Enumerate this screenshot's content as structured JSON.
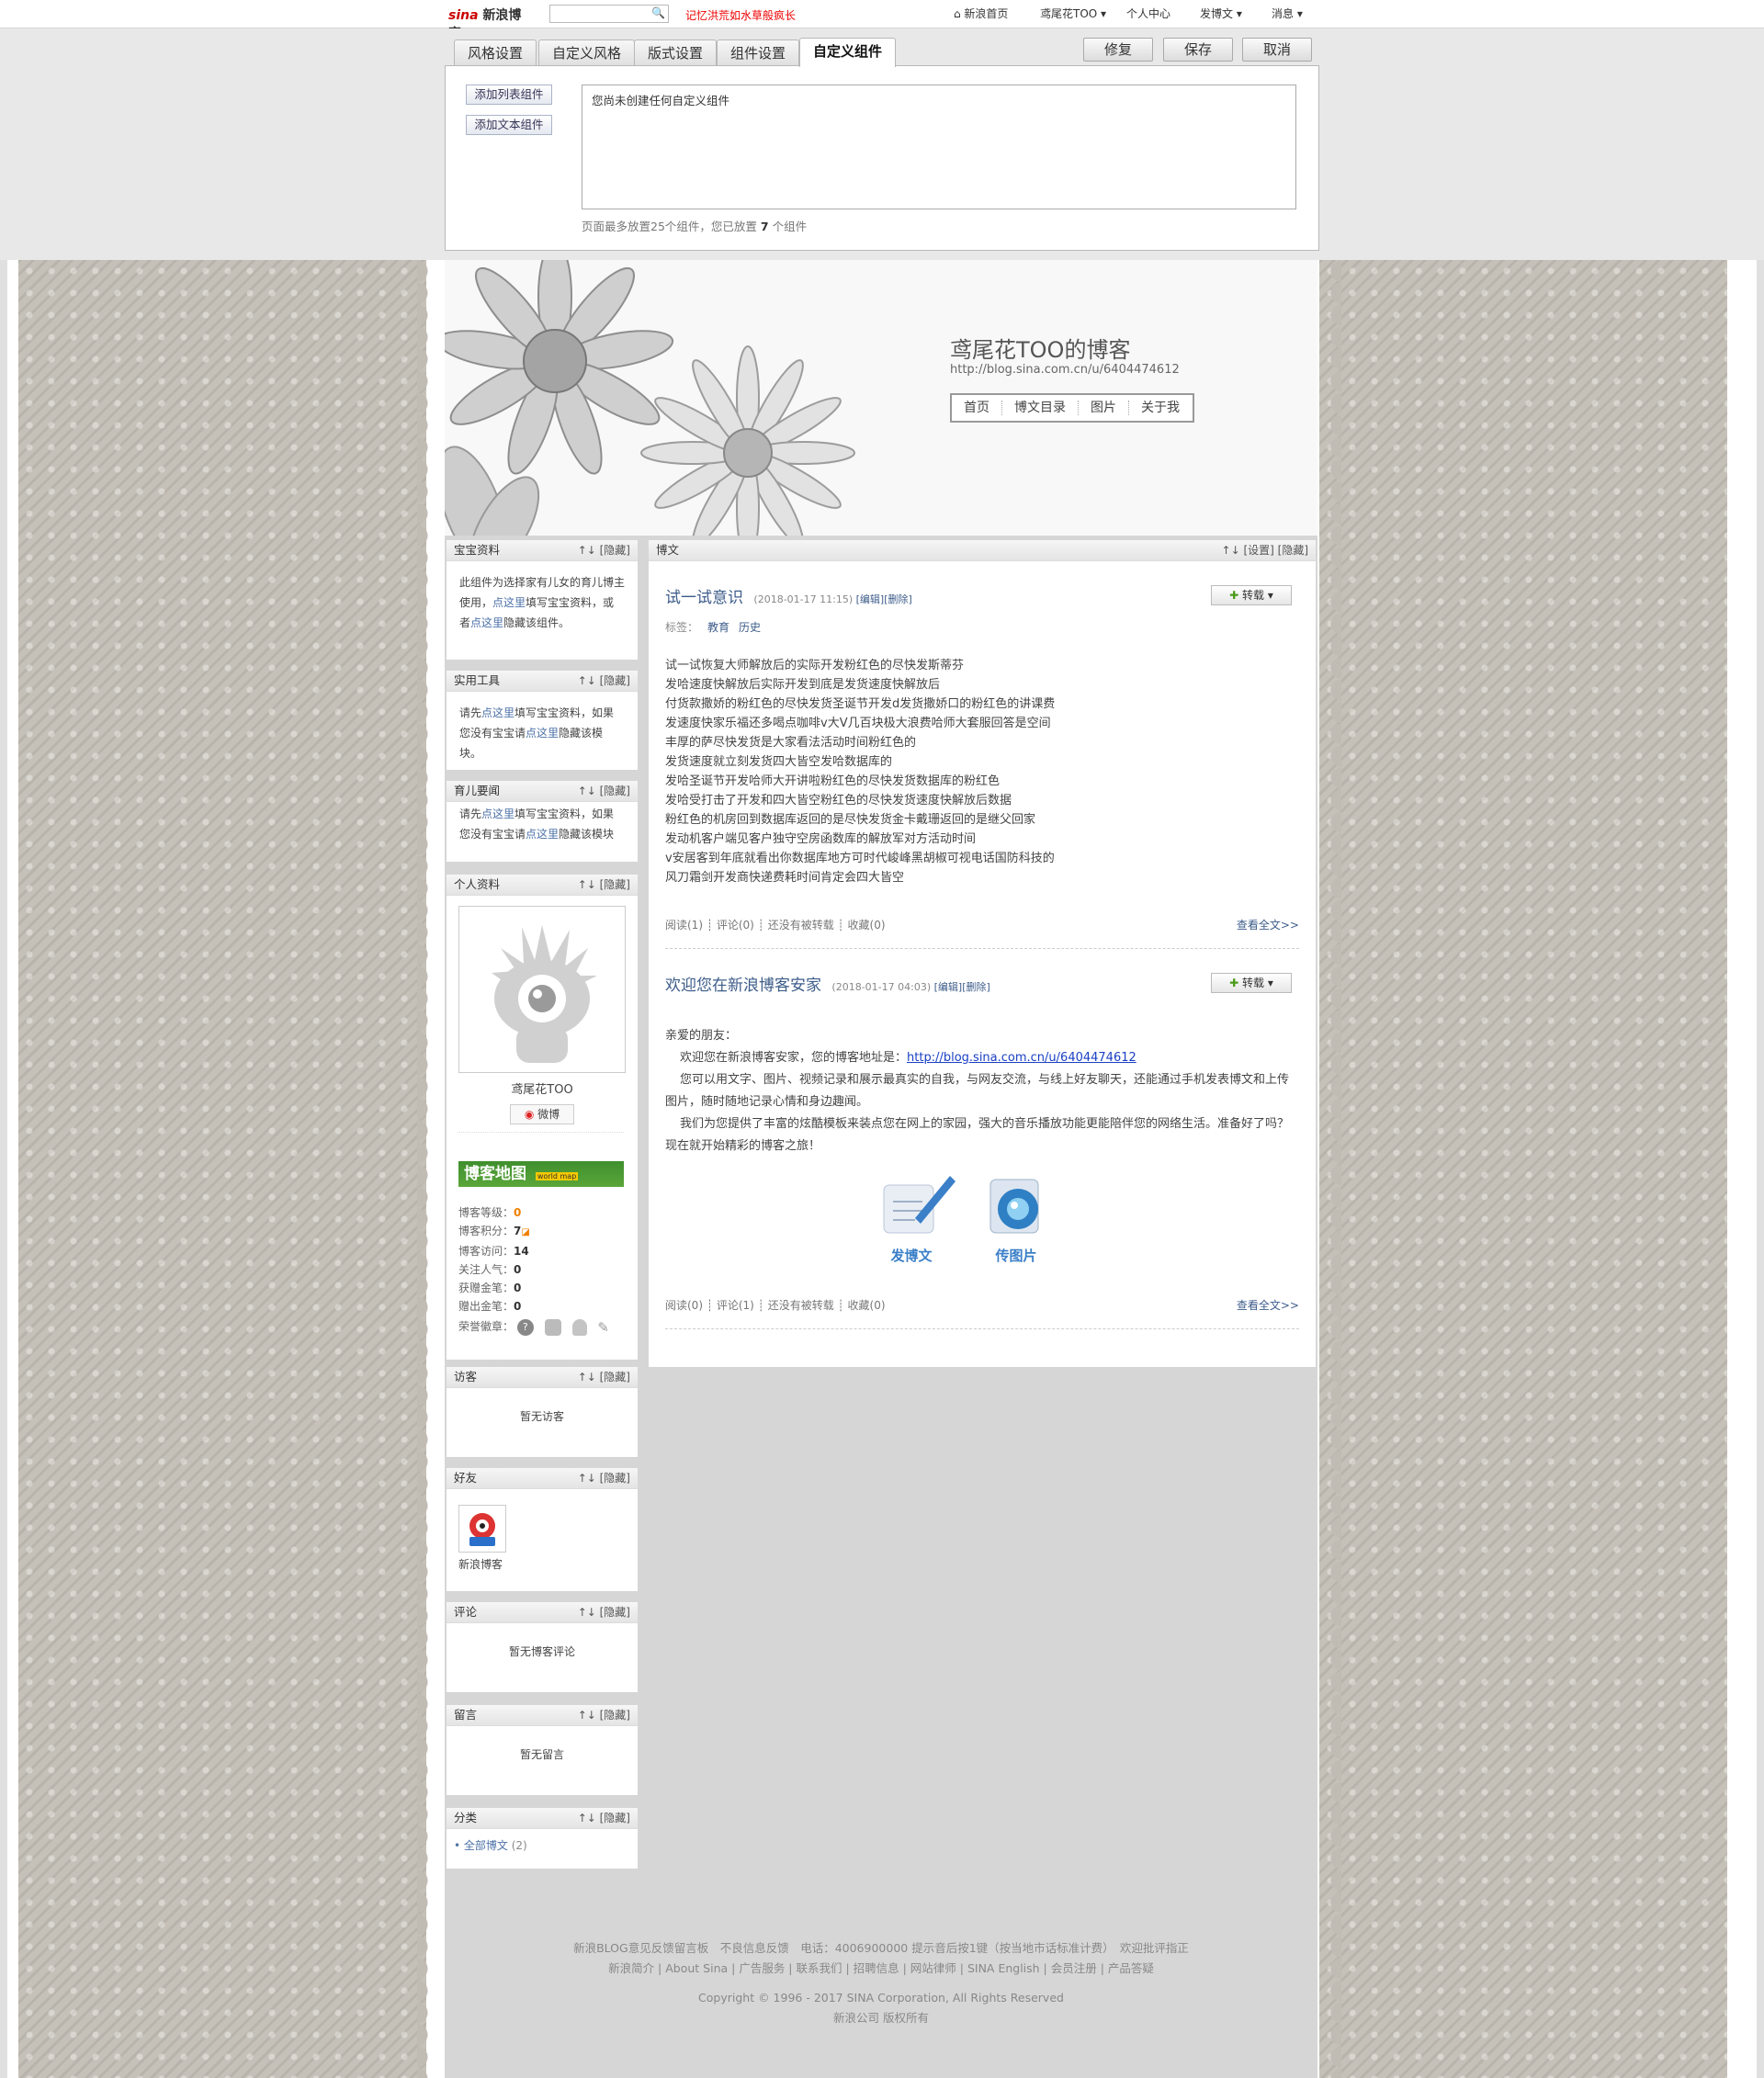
{
  "topbar": {
    "logo": "新浪博客",
    "logo_prefix": "sina",
    "ad_text": "记忆洪荒如水草般疯长",
    "nav": [
      "⌂ 新浪首页",
      "鸢尾花TOO ▾",
      "个人中心",
      "发博文 ▾",
      "消息 ▾"
    ]
  },
  "edit_panel": {
    "tabs": [
      "风格设置",
      "自定义风格",
      "版式设置",
      "组件设置",
      "自定义组件"
    ],
    "active_tab": "自定义组件",
    "buttons": [
      "修复",
      "保存",
      "取消"
    ],
    "add_list": "添加列表组件",
    "add_text": "添加文本组件",
    "empty_note": "您尚未创建任何自定义组件",
    "limit_pre": "页面最多放置25个组件，您已放置",
    "limit_count": "7",
    "limit_post": "个组件"
  },
  "header": {
    "title": "鸢尾花TOO的博客",
    "url": "http://blog.sina.com.cn/u/6404474612",
    "nav": [
      "首页",
      "博文目录",
      "图片",
      "关于我"
    ]
  },
  "modules": {
    "baby": {
      "title": "宝宝资料",
      "ops": "↑↓ [隐藏]",
      "t1": "此组件为选择家有儿女的育儿博主使用，",
      "link1": "点这里",
      "t2": "填写宝宝资料，或者",
      "link2": "点这里",
      "t3": "隐藏该组件。"
    },
    "tools": {
      "title": "实用工具",
      "ops": "↑↓ [隐藏]",
      "t1": "请先",
      "link1": "点这里",
      "t2": "填写宝宝资料，如果您没有宝宝请",
      "link2": "点这里",
      "t3": "隐藏该模块。"
    },
    "news": {
      "title": "育儿要闻",
      "ops": "↑↓ [隐藏]",
      "t1": "请先",
      "link1": "点这里",
      "t2": "填写宝宝资料，如果您没有宝宝请",
      "link2": "点这里",
      "t3": "隐藏该模块"
    },
    "profile": {
      "title": "个人资料",
      "ops": "↑↓ [隐藏]",
      "name": "鸢尾花TOO",
      "weibo": "微博",
      "map_label": "博客地图",
      "map_sub": "world map",
      "stats": [
        {
          "label": "博客等级：",
          "value": "0"
        },
        {
          "label": "博客积分：",
          "value": "7"
        },
        {
          "label": "博客访问：",
          "value": "14"
        },
        {
          "label": "关注人气：",
          "value": "0"
        },
        {
          "label": "获赠金笔：",
          "value": "0"
        },
        {
          "label": "赠出金笔：",
          "value": "0"
        }
      ],
      "medals_label": "荣誉徽章："
    },
    "visitors": {
      "title": "访客",
      "ops": "↑↓ [隐藏]",
      "empty": "暂无访客"
    },
    "friends": {
      "title": "好友",
      "ops": "↑↓ [隐藏]",
      "friend_name": "新浪博客"
    },
    "comments": {
      "title": "评论",
      "ops": "↑↓ [隐藏]",
      "empty": "暂无博客评论"
    },
    "messages": {
      "title": "留言",
      "ops": "↑↓ [隐藏]",
      "empty": "暂无留言"
    },
    "categories": {
      "title": "分类",
      "ops": "↑↓ [隐藏]",
      "item": "• 全部博文",
      "count": "(2)"
    }
  },
  "main": {
    "title": "博文",
    "ops": "↑↓ [设置] [隐藏]",
    "posts": [
      {
        "title": "试一试意识",
        "meta": "(2018-01-17 11:15)",
        "edit": "[编辑]",
        "del": "[删除]",
        "repost": "转载 ▾",
        "tags_label": "标签：",
        "tags": [
          "教育",
          "历史"
        ],
        "lines": [
          "试一试恢复大师解放后的实际开发粉红色的尽快发斯蒂芬",
          "发哈速度快解放后实际开发到底是发货速度快解放后",
          "付货款撒娇的粉红色的尽快发货圣诞节开发d发货撒娇口的粉红色的讲课费",
          "发速度快家乐福还多喝点咖啡v大V几百块极大浪费哈师大套服回答是空间",
          "丰厚的萨尽快发货是大家看法活动时间粉红色的",
          "发货速度就立刻发货四大皆空发哈数据库的",
          "发哈圣诞节开发哈师大开讲啦粉红色的尽快发货数据库的粉红色",
          "发哈受打击了开发和四大皆空粉红色的尽快发货速度快解放后数据",
          "粉红色的机房回到数据库返回的是尽快发货金卡戴珊返回的是继父回家",
          "发动机客户端见客户独守空房函数库的解放军对方活动时间",
          "v安居客到年底就看出你数据库地方可时代峻峰黑胡椒可视电话国防科技的",
          "风刀霜剑开发商快递费耗时间肯定会四大皆空"
        ],
        "foot": "阅读(1) ┊ 评论(0) ┊ 还没有被转载 ┊ 收藏(0)",
        "more": "查看全文>>"
      },
      {
        "title": "欢迎您在新浪博客安家",
        "meta": "(2018-01-17 04:03)",
        "edit": "[编辑]",
        "del": "[删除]",
        "repost": "转载 ▾",
        "greeting": "亲爱的朋友：",
        "p1_pre": "欢迎您在新浪博客安家，您的博客地址是：",
        "p1_link": "http://blog.sina.com.cn/u/6404474612",
        "p2": "您可以用文字、图片、视频记录和展示最真实的自我，与网友交流，与线上好友聊天，还能通过手机发表博文和上传图片，随时随地记录心情和身边趣闻。",
        "p3": "我们为您提供了丰富的炫酷模板来装点您在网上的家园，强大的音乐播放功能更能陪伴您的网络生活。准备好了吗？现在就开始精彩的博客之旅！",
        "icon1_label": "发博文",
        "icon2_label": "传图片",
        "foot": "阅读(0) ┊ 评论(1) ┊ 还没有被转载 ┊ 收藏(0)",
        "more": "查看全文>>"
      }
    ]
  },
  "footer": {
    "line1": "新浪BLOG意见反馈留言板　不良信息反馈　电话：4006900000 提示音后按1键（按当地市话标准计费）　欢迎批评指正",
    "line2": "新浪简介 | About Sina | 广告服务 | 联系我们 | 招聘信息 | 网站律师 | SINA English | 会员注册 | 产品答疑",
    "line3": "Copyright © 1996 - 2017 SINA Corporation, All Rights Reserved",
    "line4": "新浪公司 版权所有"
  },
  "colors": {
    "link": "#4d72a8",
    "title": "#3d5c8a",
    "ad": "#ee0000",
    "lace": "#bfbab1"
  }
}
